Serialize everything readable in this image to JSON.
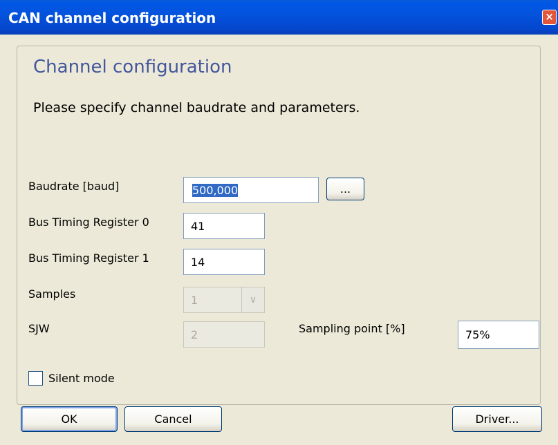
{
  "window": {
    "title": "CAN channel configuration",
    "close_label": "×"
  },
  "heading": "Channel configuration",
  "subtitle": "Please specify channel baudrate and parameters.",
  "fields": {
    "baudrate": {
      "label": "Baudrate [baud]",
      "value": "500,000",
      "browse_label": "..."
    },
    "btr0": {
      "label": "Bus Timing Register 0",
      "value": "41"
    },
    "btr1": {
      "label": "Bus Timing Register 1",
      "value": "14"
    },
    "samples": {
      "label": "Samples",
      "value": "1"
    },
    "sjw": {
      "label": "SJW",
      "value": "2"
    },
    "sampling_point": {
      "label": "Sampling point [%]",
      "value": "75%"
    }
  },
  "silent_mode": {
    "label": "Silent mode",
    "checked": false
  },
  "buttons": {
    "ok": "OK",
    "cancel": "Cancel",
    "driver": "Driver..."
  }
}
